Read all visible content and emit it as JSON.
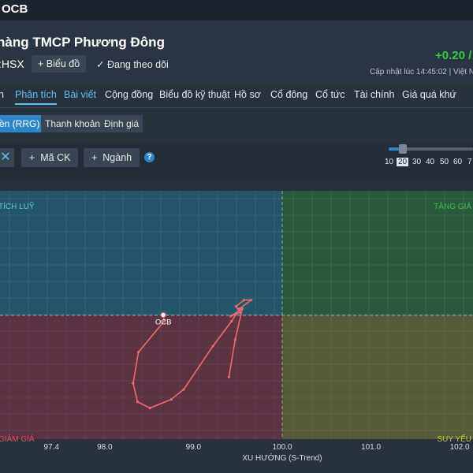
{
  "topbar": {
    "ticker": "OCB"
  },
  "header": {
    "company_name": "hàng TMCP Phương Đông",
    "exchange": ":HSX",
    "add_chart_label": "Biểu đồ",
    "add_chart_icon": "plus-icon",
    "following_label": "Đang theo dõi",
    "following_icon": "check-icon",
    "price_change": "+0.20 /",
    "update_text": "Cập nhật lúc  14:45:02 | Việt Nam",
    "positive_color": "#2ecc40"
  },
  "tabs": [
    "n",
    "Phân tích",
    "Bài viết",
    "Cộng đồng",
    "Biểu đồ kỹ thuật",
    "Hồ sơ",
    "Cổ đông",
    "Cổ tức",
    "Tài chính",
    "Giá quá khứ"
  ],
  "subtabs": [
    "ền (RRG)",
    "Thanh khoản",
    "Định giá"
  ],
  "toolbar": {
    "close_symbol": "✕",
    "add_stock_label": "Mã CK",
    "add_industry_label": "Ngành",
    "help_symbol": "?",
    "periods": [
      "10",
      "20",
      "30",
      "40",
      "50",
      "60",
      "7"
    ],
    "selected_period": "20"
  },
  "chart_data": {
    "type": "scatter",
    "title": "",
    "xlabel": "XU HƯỚNG (S-Trend)",
    "ylabel": "",
    "xlim": [
      96.82,
      102.15
    ],
    "x_ticks": [
      "97.4",
      "98.0",
      "99.0",
      "100.0",
      "101.0",
      "102.0"
    ],
    "center": 100.0,
    "grid": true,
    "quadrants": {
      "top_left": {
        "label": "TÍCH LUỸ",
        "color": "#5ec8e0"
      },
      "top_right": {
        "label": "TĂNG GIÁ",
        "color": "#3fbf4f"
      },
      "bottom_left": {
        "label": "GIẢM GIÁ",
        "color": "#e0505a"
      },
      "bottom_right": {
        "label": "SUY YẾU",
        "color": "#d4c640"
      }
    },
    "series": [
      {
        "name": "OCB",
        "color": "#f06a6a",
        "x": [
          98.66,
          98.67,
          98.38,
          98.32,
          98.37,
          98.51,
          98.75,
          98.89,
          99.22,
          99.43,
          99.52,
          99.65,
          99.57,
          99.48,
          99.53,
          99.42,
          99.55,
          99.47,
          99.4
        ],
        "y": [
          100.0,
          99.95,
          99.7,
          99.45,
          99.3,
          99.25,
          99.32,
          99.4,
          99.75,
          99.95,
          100.05,
          100.12,
          100.12,
          100.07,
          100.02,
          99.99,
          100.05,
          99.8,
          99.5
        ]
      }
    ]
  }
}
